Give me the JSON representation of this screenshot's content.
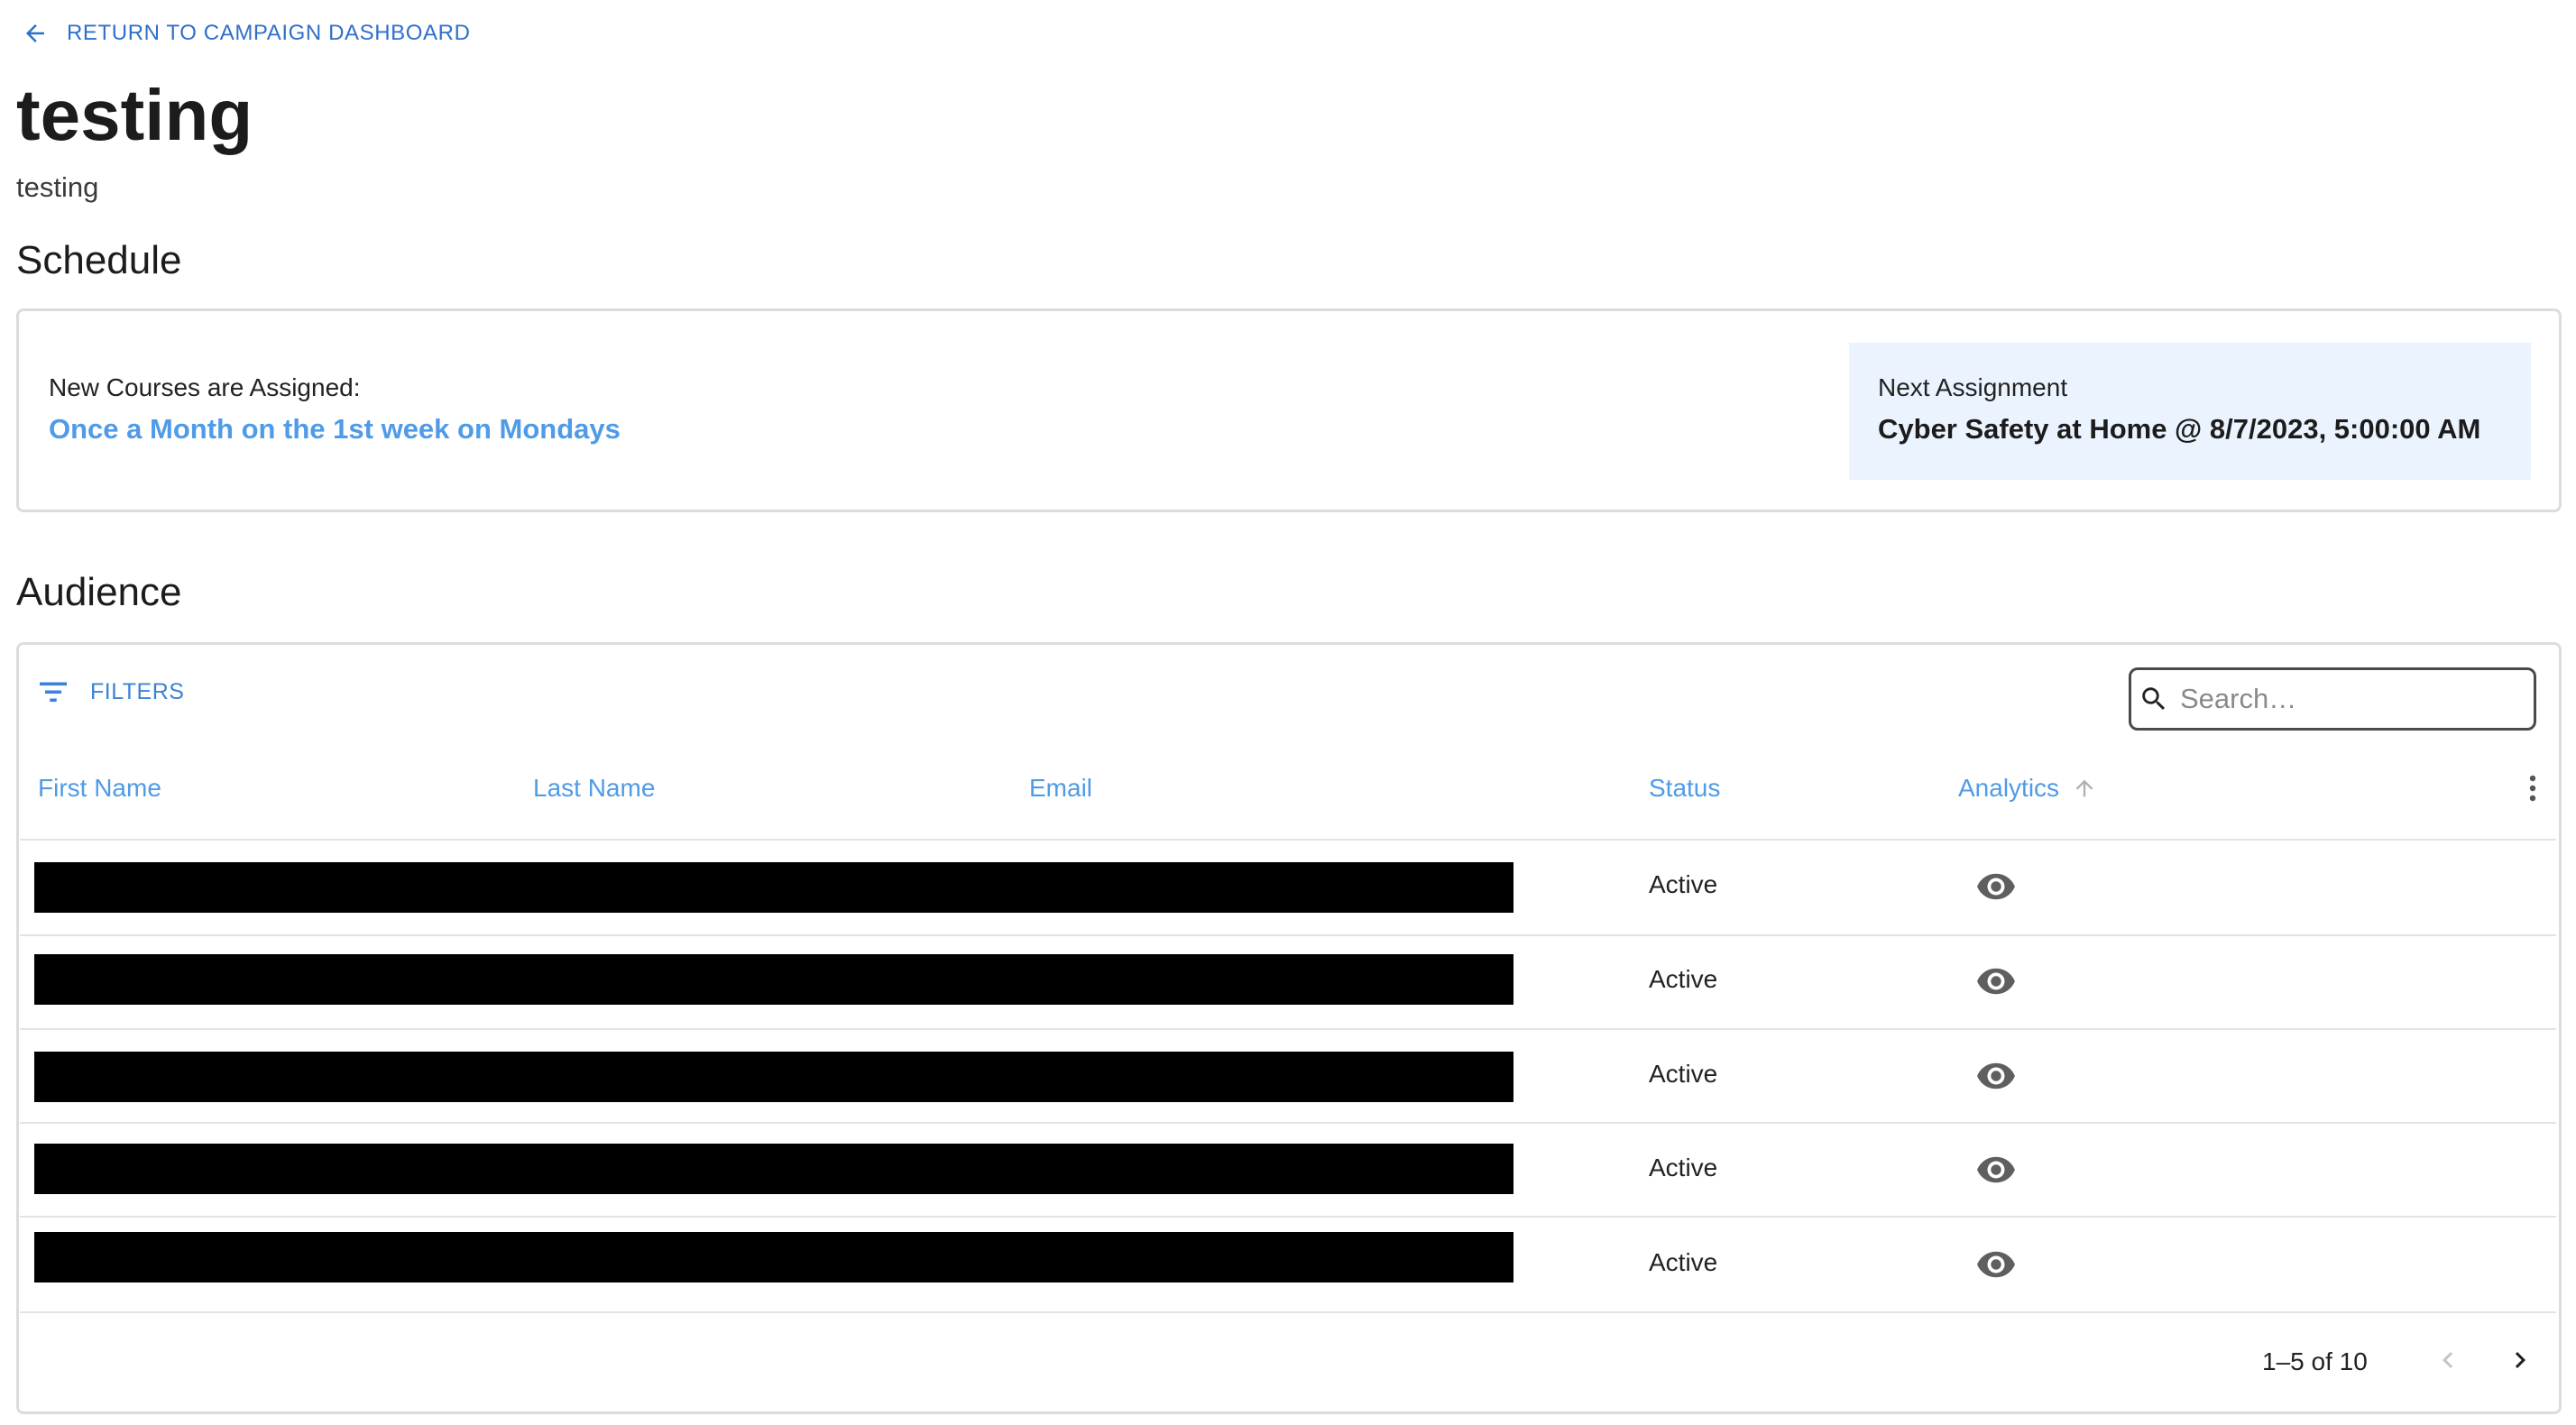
{
  "nav": {
    "back_label": "RETURN TO CAMPAIGN DASHBOARD"
  },
  "campaign": {
    "title": "testing",
    "description": "testing"
  },
  "schedule": {
    "heading": "Schedule",
    "assigned_label": "New Courses are Assigned:",
    "assigned_value": "Once a Month on the 1st week on Mondays",
    "next_label": "Next Assignment",
    "next_value": "Cyber Safety at Home @ 8/7/2023, 5:00:00 AM"
  },
  "audience": {
    "heading": "Audience",
    "filters_label": "FILTERS",
    "search_placeholder": "Search…",
    "columns": [
      "First Name",
      "Last Name",
      "Email",
      "Status",
      "Analytics"
    ],
    "sort": {
      "column": "Analytics",
      "direction": "ascending"
    },
    "rows": [
      {
        "first_name": "[redacted]",
        "last_name": "[redacted]",
        "email": "[redacted]",
        "status": "Active"
      },
      {
        "first_name": "[redacted]",
        "last_name": "[redacted]",
        "email": "[redacted]",
        "status": "Active"
      },
      {
        "first_name": "[redacted]",
        "last_name": "[redacted]",
        "email": "[redacted]",
        "status": "Active"
      },
      {
        "first_name": "[redacted]",
        "last_name": "[redacted]",
        "email": "[redacted]",
        "status": "Active"
      },
      {
        "first_name": "[redacted]",
        "last_name": "[redacted]",
        "email": "[redacted]",
        "status": "Active"
      }
    ],
    "pagination": {
      "range_label": "1–5 of 10"
    }
  },
  "icons": {
    "back": "arrow-left-icon",
    "filter": "filter-list-icon",
    "search": "search-icon",
    "sort": "arrow-up-icon",
    "column_menu": "more-vert-icon",
    "analytics": "eye-icon",
    "prev": "chevron-left-icon",
    "next": "chevron-right-icon"
  },
  "colors": {
    "link_blue": "#2f6fcc",
    "accent_blue": "#4f9be8",
    "next_box_bg": "#ebf3fe",
    "border": "#dcdcdc"
  }
}
